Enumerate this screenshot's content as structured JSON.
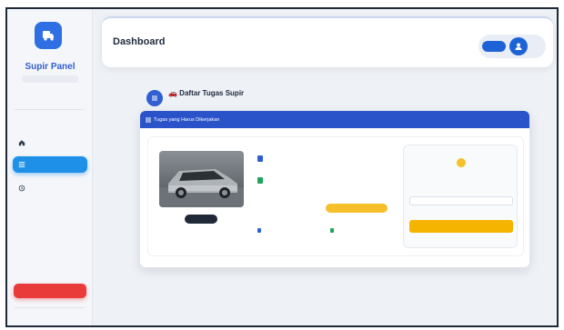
{
  "sidebar": {
    "brand": "Supir Panel",
    "brand_sub": "",
    "menu_label": "",
    "items": [
      {
        "label": "",
        "icon": "home-icon",
        "active": false
      },
      {
        "label": "",
        "icon": "list-icon",
        "active": true
      },
      {
        "label": "",
        "icon": "history-icon",
        "active": false
      }
    ],
    "logout_label": "",
    "footer": ""
  },
  "header": {
    "title": "Dashboard",
    "user_button": "",
    "user_name": ""
  },
  "section": {
    "title": "🚗 Daftar Tugas Supir",
    "subtitle": ""
  },
  "card": {
    "header": "Tugas yang Harus Dikerjakan",
    "plate": "",
    "status": "",
    "fields": [
      {
        "label": "",
        "value": ""
      },
      {
        "label": "",
        "value": ""
      },
      {
        "label": "",
        "value": ""
      },
      {
        "label": "",
        "value": ""
      },
      {
        "label": "",
        "value": ""
      },
      {
        "label": "",
        "value": ""
      }
    ],
    "panel": {
      "title": "",
      "subtitle": "",
      "input_value": "",
      "note": "",
      "button": ""
    }
  },
  "colors": {
    "accent": "#2f5fd0",
    "active_nav": "#1e90e8",
    "logout": "#ea3b3b",
    "status": "#f6c02b",
    "button": "#f4b400"
  }
}
